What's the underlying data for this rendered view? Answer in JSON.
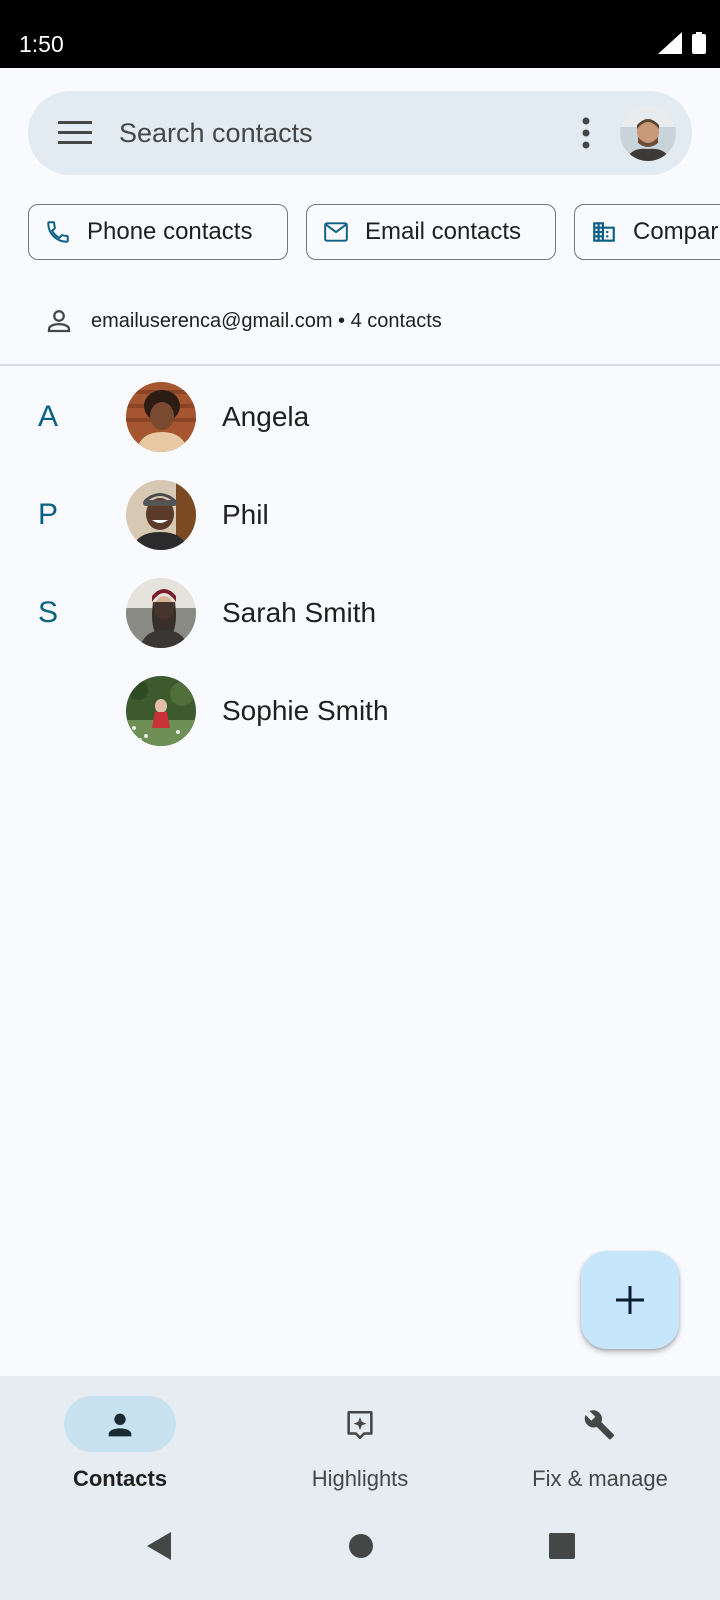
{
  "status_bar": {
    "time": "1:50",
    "icons": [
      "signal-icon",
      "battery-icon"
    ]
  },
  "search": {
    "placeholder": "Search contacts",
    "icons": [
      "menu-icon",
      "more-vert-icon",
      "account-avatar"
    ]
  },
  "chips": [
    {
      "label": "Phone contacts",
      "icon": "phone-icon"
    },
    {
      "label": "Email contacts",
      "icon": "email-icon"
    },
    {
      "label": "Compar",
      "icon": "company-icon"
    }
  ],
  "account": {
    "text": "emailuserenca@gmail.com • 4 contacts",
    "icon": "person-outline-icon"
  },
  "contacts": [
    {
      "letter": "A",
      "name": "Angela"
    },
    {
      "letter": "P",
      "name": "Phil"
    },
    {
      "letter": "S",
      "name": "Sarah Smith"
    },
    {
      "letter": "",
      "name": "Sophie Smith"
    }
  ],
  "fab": {
    "icon": "add-icon"
  },
  "bottom_nav": [
    {
      "label": "Contacts",
      "icon": "person-icon",
      "active": true
    },
    {
      "label": "Highlights",
      "icon": "highlights-icon",
      "active": false
    },
    {
      "label": "Fix & manage",
      "icon": "wrench-icon",
      "active": false
    }
  ],
  "colors": {
    "accent": "#0b6085",
    "search_bg": "#e2ebf1",
    "fab_bg": "#c5e6fb",
    "nav_bg": "#e5edf3",
    "active_pill": "#c8e1ee"
  }
}
